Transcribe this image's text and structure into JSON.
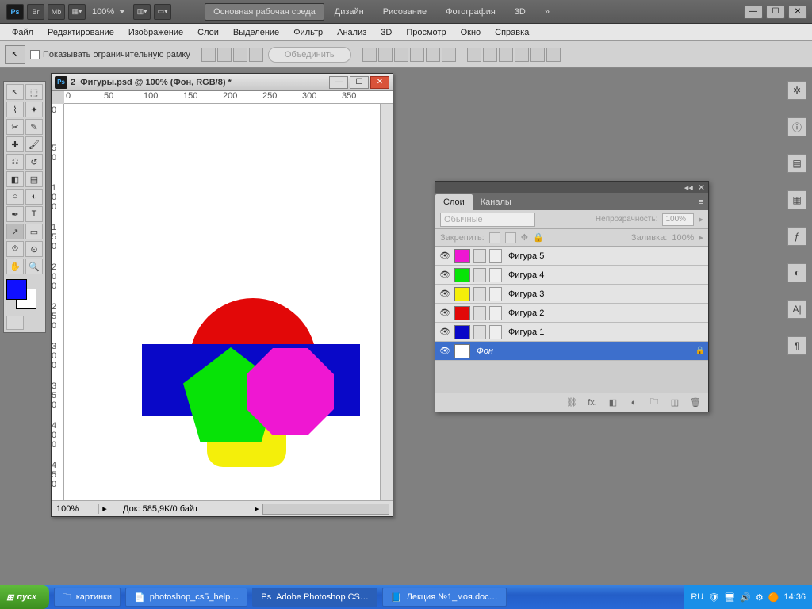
{
  "appbar": {
    "zoom": "100%",
    "tabs": {
      "main": "Основная рабочая среда",
      "design": "Дизайн",
      "paint": "Рисование",
      "photo": "Фотография",
      "3d": "3D"
    }
  },
  "menubar": [
    "Файл",
    "Редактирование",
    "Изображение",
    "Слои",
    "Выделение",
    "Фильтр",
    "Анализ",
    "3D",
    "Просмотр",
    "Окно",
    "Справка"
  ],
  "optbar": {
    "checkbox": "Показывать ограничительную рамку",
    "combine": "Объединить"
  },
  "doc": {
    "title": "2_Фигуры.psd @ 100% (Фон, RGB/8) *",
    "zoom": "100%",
    "status": "Док: 585,9K/0 байт"
  },
  "layersPanel": {
    "tabs": {
      "layers": "Слои",
      "channels": "Каналы"
    },
    "blend": "Обычные",
    "opacityLabel": "Непрозрачность:",
    "opacityVal": "100%",
    "lockLabel": "Закрепить:",
    "fillLabel": "Заливка:",
    "fillVal": "100%",
    "layers": [
      {
        "name": "Фигура 5",
        "color": "#ef17d2"
      },
      {
        "name": "Фигура 4",
        "color": "#07e307"
      },
      {
        "name": "Фигура 3",
        "color": "#f4ef0a"
      },
      {
        "name": "Фигура 2",
        "color": "#e20808"
      },
      {
        "name": "Фигура 1",
        "color": "#0908c8"
      }
    ],
    "bgLayer": "Фон"
  },
  "taskbar": {
    "start": "пуск",
    "tasks": [
      "картинки",
      "photoshop_cs5_help…",
      "Adobe Photoshop CS…",
      "Лекция №1_моя.doc…"
    ],
    "lang": "RU",
    "time": "14:36"
  },
  "colors": {
    "fg": "#1010ff",
    "bg": "#ffffff"
  }
}
